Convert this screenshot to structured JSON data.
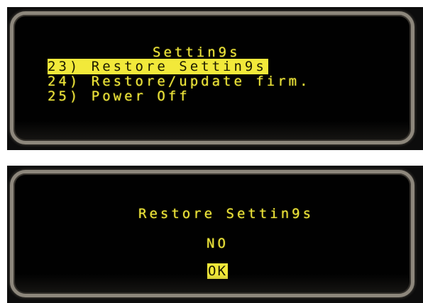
{
  "screens": [
    {
      "title": "Settin9s",
      "menu": [
        {
          "number": "23)",
          "label": "Restore Settin9s",
          "selected": true
        },
        {
          "number": "24)",
          "label": "Restore/update firm.",
          "selected": false
        },
        {
          "number": "25)",
          "label": "Power Off",
          "selected": false
        }
      ]
    },
    {
      "title": "Restore Settin9s",
      "options": [
        {
          "label": "NO",
          "selected": false
        },
        {
          "label": "OK",
          "selected": true
        }
      ]
    }
  ],
  "colors": {
    "lcd_text": "#f2e93a",
    "lcd_background": "#010101",
    "bezel": "#8d877c",
    "highlight_text": "#1c1a00"
  }
}
